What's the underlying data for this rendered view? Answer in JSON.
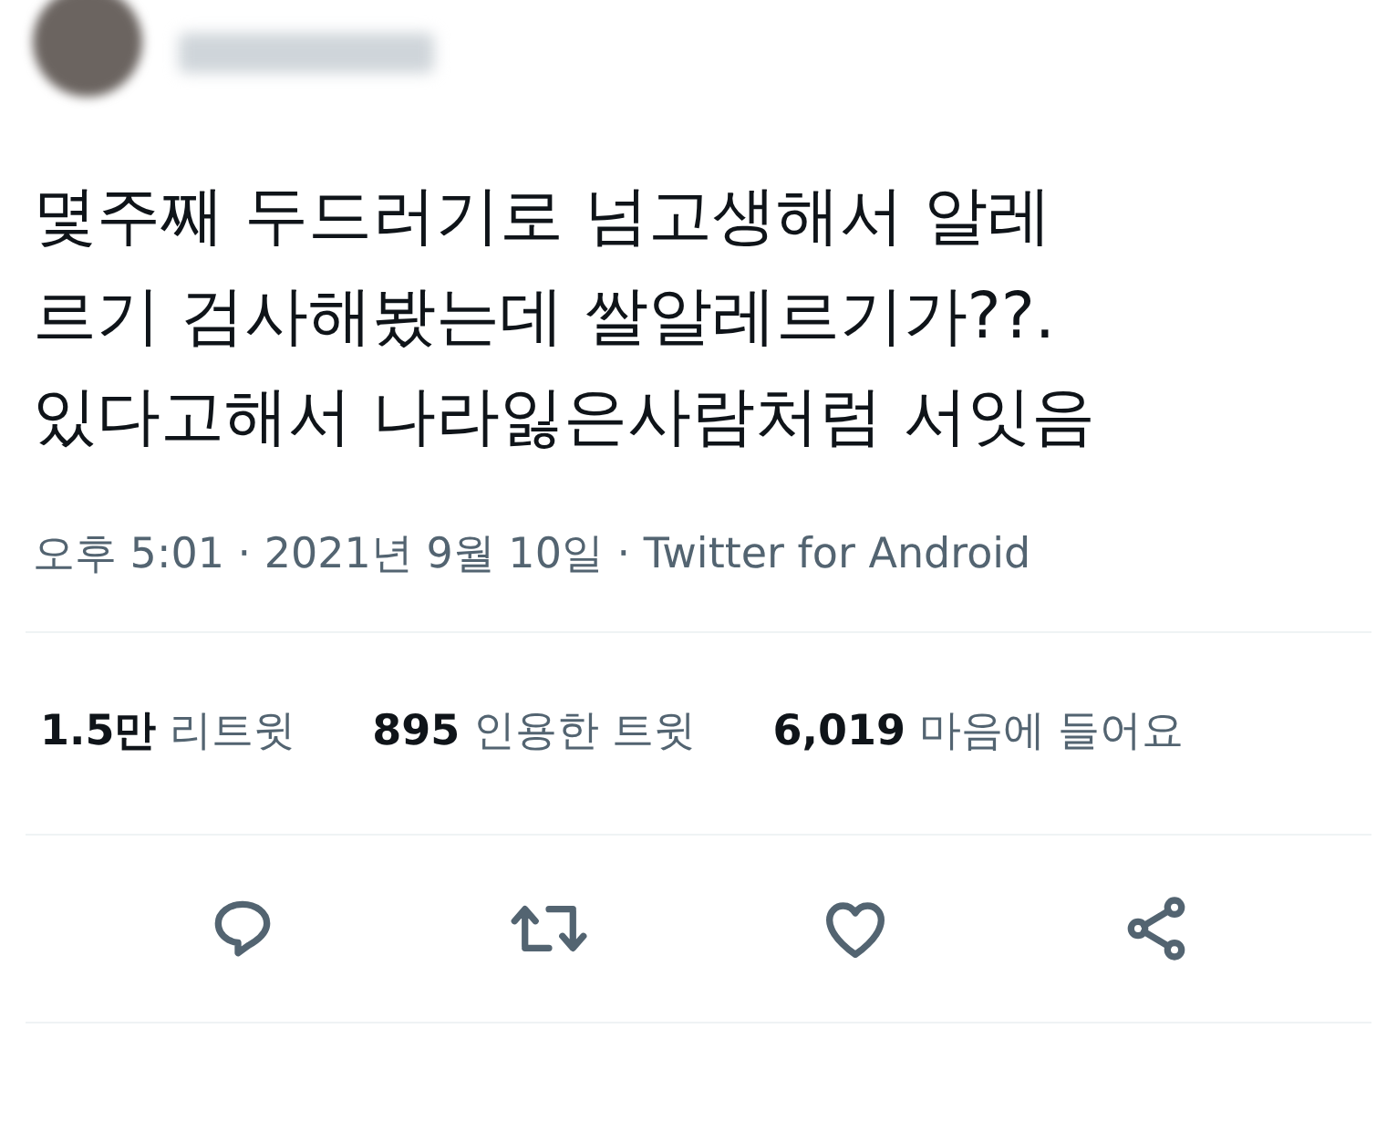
{
  "tweet": {
    "text": "몇주째 두드러기로 넘고생해서 알레\n르기 검사해봤는데 쌀알레르기가??.\n있다고해서 나라잃은사람처럼 서잇음",
    "meta": "오후 5:01 · 2021년 9월 10일 · Twitter for Android"
  },
  "stats": [
    {
      "text": "**1.5만** 리트윗"
    },
    {
      "text": "**895** 인용한 트윗"
    },
    {
      "text": "**6,019** 마음에 들어요"
    }
  ],
  "actions": [
    {
      "kind": "reply"
    },
    {
      "kind": "retweet"
    },
    {
      "kind": "like"
    },
    {
      "kind": "share"
    }
  ]
}
